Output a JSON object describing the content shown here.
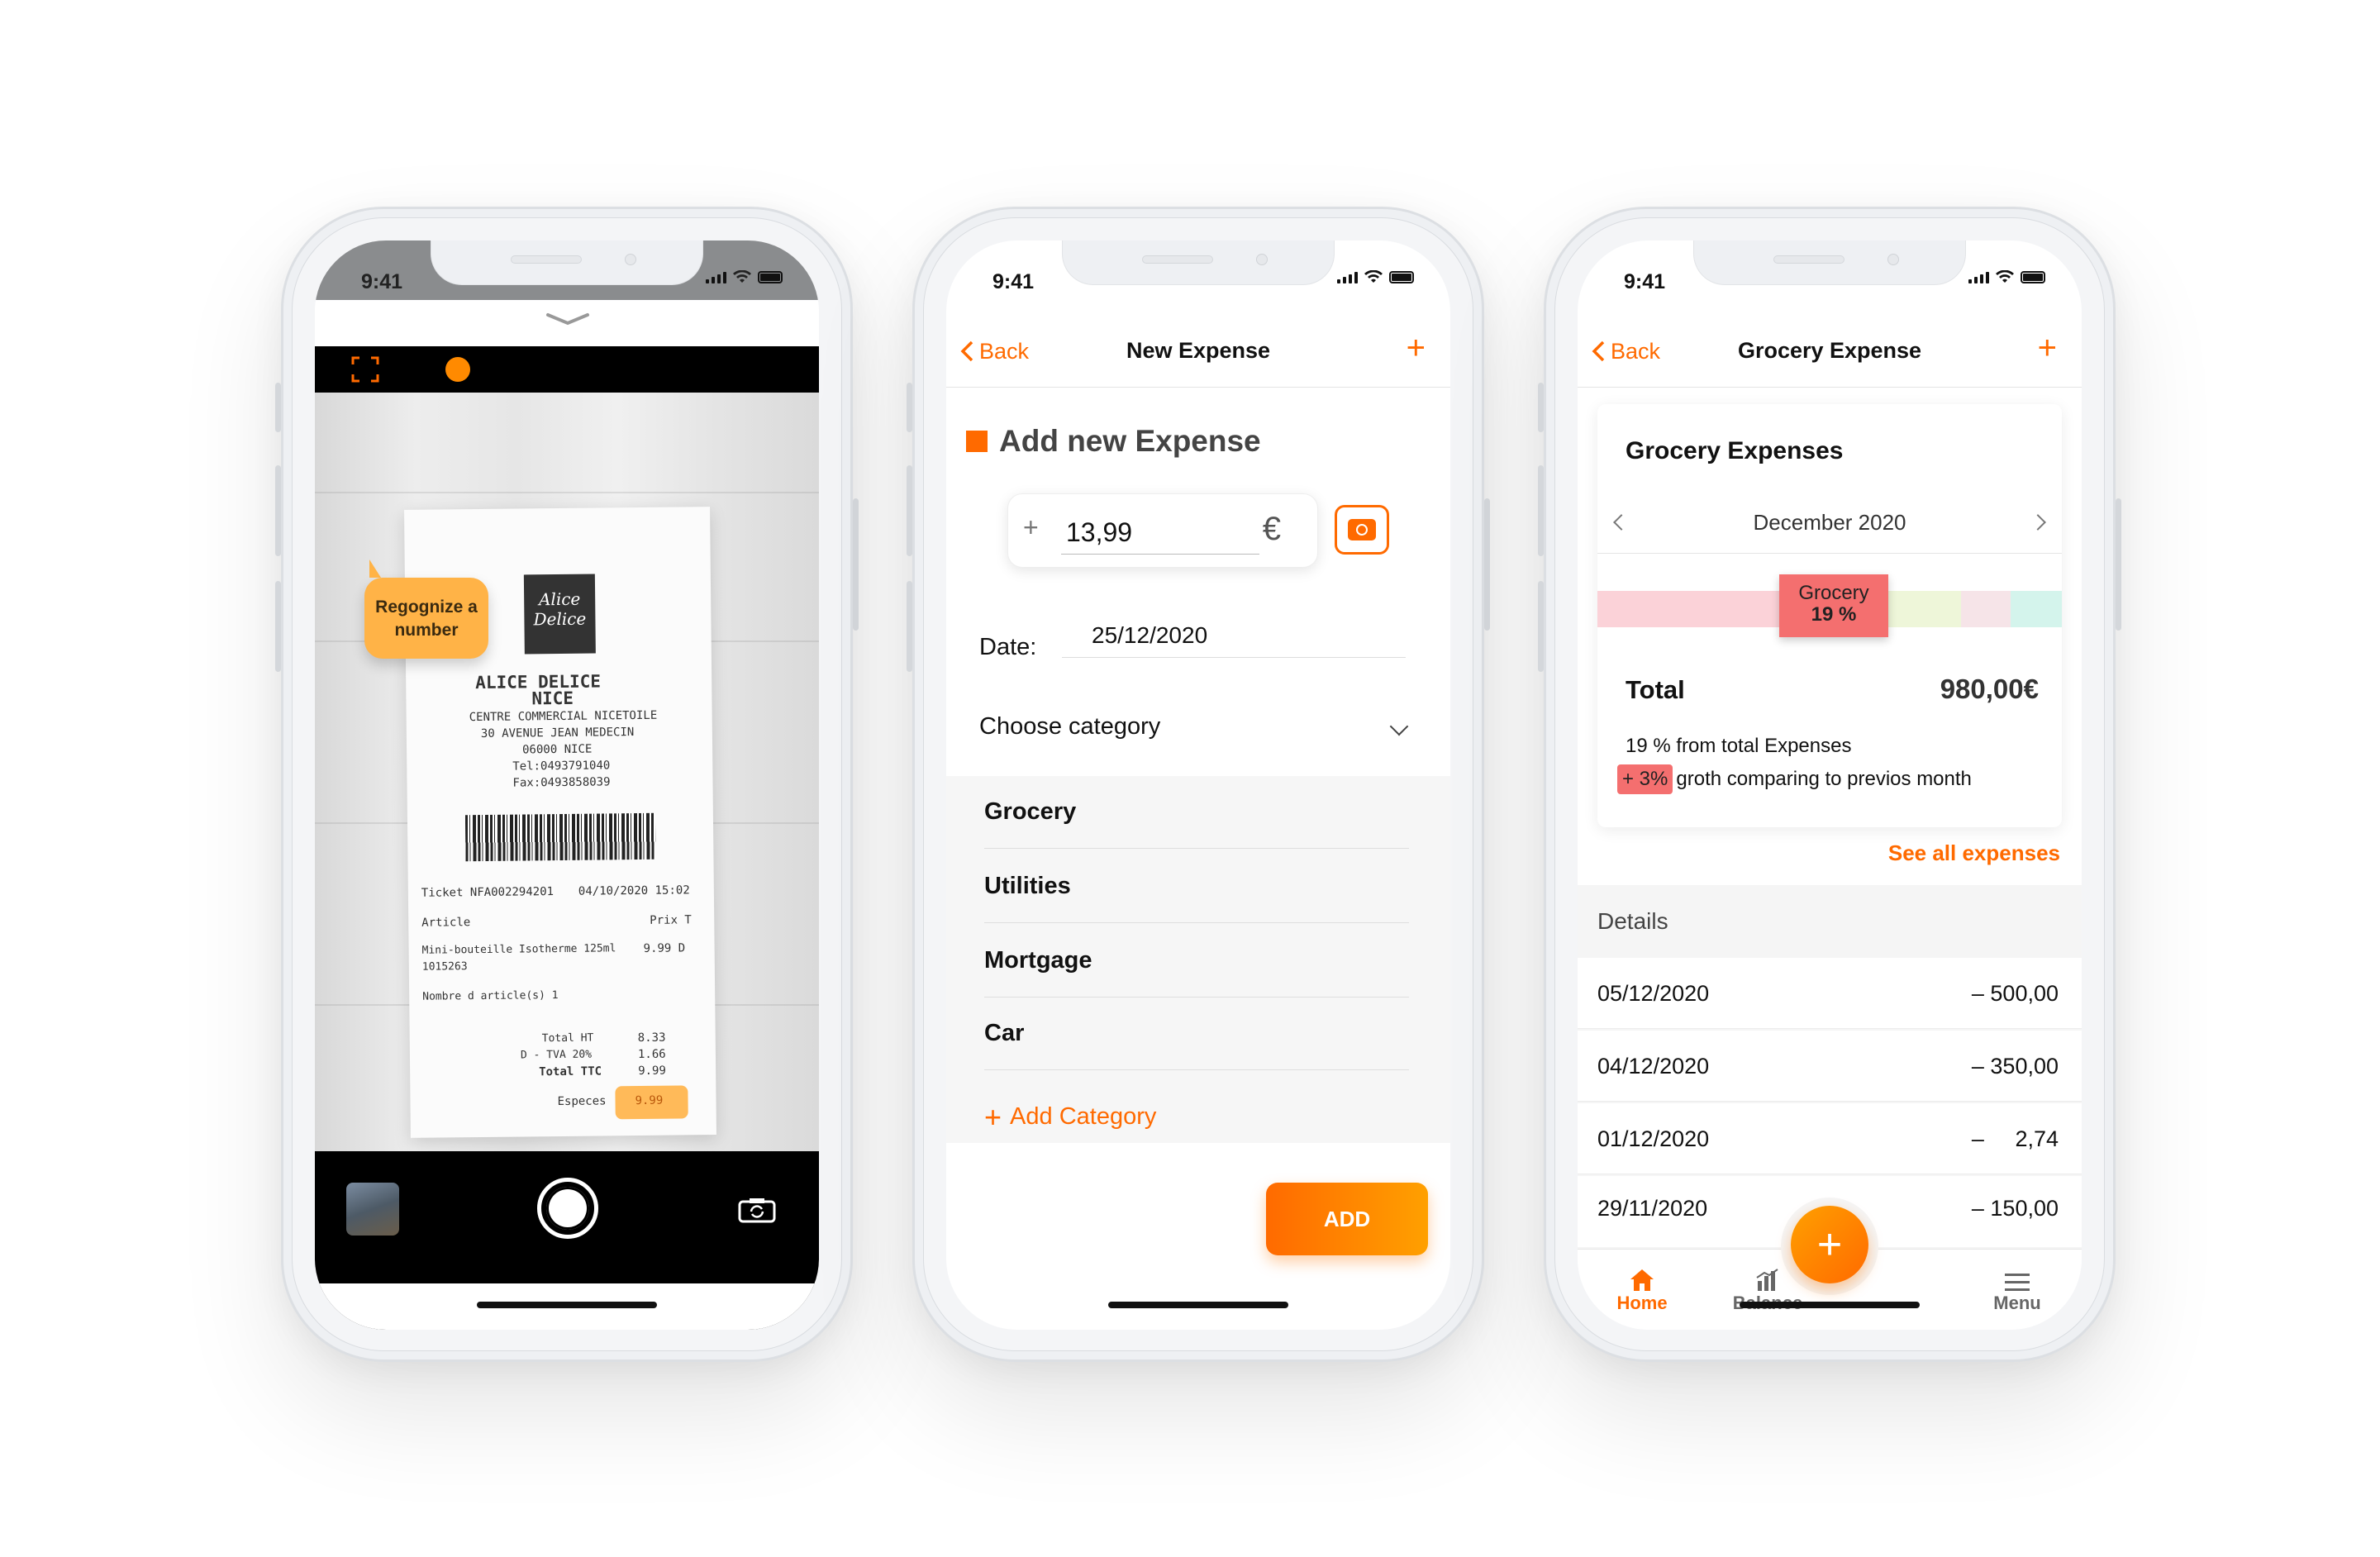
{
  "status_time": "9:41",
  "phone1": {
    "bubble_text": "Regognize a number",
    "receipt": {
      "store": "ALICE DELICE",
      "city": "NICE",
      "address1": "CENTRE COMMERCIAL NICETOILE",
      "address2": "30 AVENUE JEAN MEDECIN",
      "address3": "06000 NICE",
      "tel": "Tel:0493791040",
      "fax": "Fax:0493858039",
      "ticket": "Ticket NFA002294201",
      "ticket_date": "04/10/2020 15:02",
      "col_article": "Article",
      "col_price": "Prix T",
      "item": "Mini-bouteille Isotherme 125ml",
      "item_price": "9.99 D",
      "item_code": "1015263",
      "count": "Nombre d article(s) 1",
      "total_ht_label": "Total HT",
      "total_ht": "8.33",
      "tva_label": "D - TVA 20%",
      "tva": "1.66",
      "ttc_label": "Total TTC",
      "ttc": "9.99",
      "especes_label": "Especes",
      "especes": "9.99",
      "logo_text": "Alice Delice"
    }
  },
  "phone2": {
    "back": "Back",
    "title": "New Expense",
    "heading": "Add new Expense",
    "amount": "13,99",
    "currency": "€",
    "date_label": "Date:",
    "date_value": "25/12/2020",
    "category_label": "Choose category",
    "categories": [
      "Grocery",
      "Utilities",
      "Mortgage",
      "Car"
    ],
    "add_category": "Add Category",
    "add_button": "ADD"
  },
  "phone3": {
    "back": "Back",
    "title": "Grocery Expense",
    "card_title": "Grocery Expenses",
    "month": "December 2020",
    "tip_name": "Grocery",
    "tip_pct": "19 %",
    "total_label": "Total",
    "total_value": "980,00€",
    "pct_text": "19 % from total Expenses",
    "growth_tag": "+ 3%",
    "growth_text": "groth comparing to previos month",
    "see_all": "See all expenses",
    "details_label": "Details",
    "details": [
      {
        "date": "05/12/2020",
        "amount": "– 500,00"
      },
      {
        "date": "04/12/2020",
        "amount": "– 350,00"
      },
      {
        "date": "01/12/2020",
        "amount": "–     2,74"
      },
      {
        "date": "29/11/2020",
        "amount": "– 150,00"
      }
    ],
    "tabs": {
      "home": "Home",
      "balance": "Balance",
      "menu": "Menu"
    },
    "colors": {
      "accent": "#ff6a00",
      "tag": "#f46f6f"
    }
  }
}
